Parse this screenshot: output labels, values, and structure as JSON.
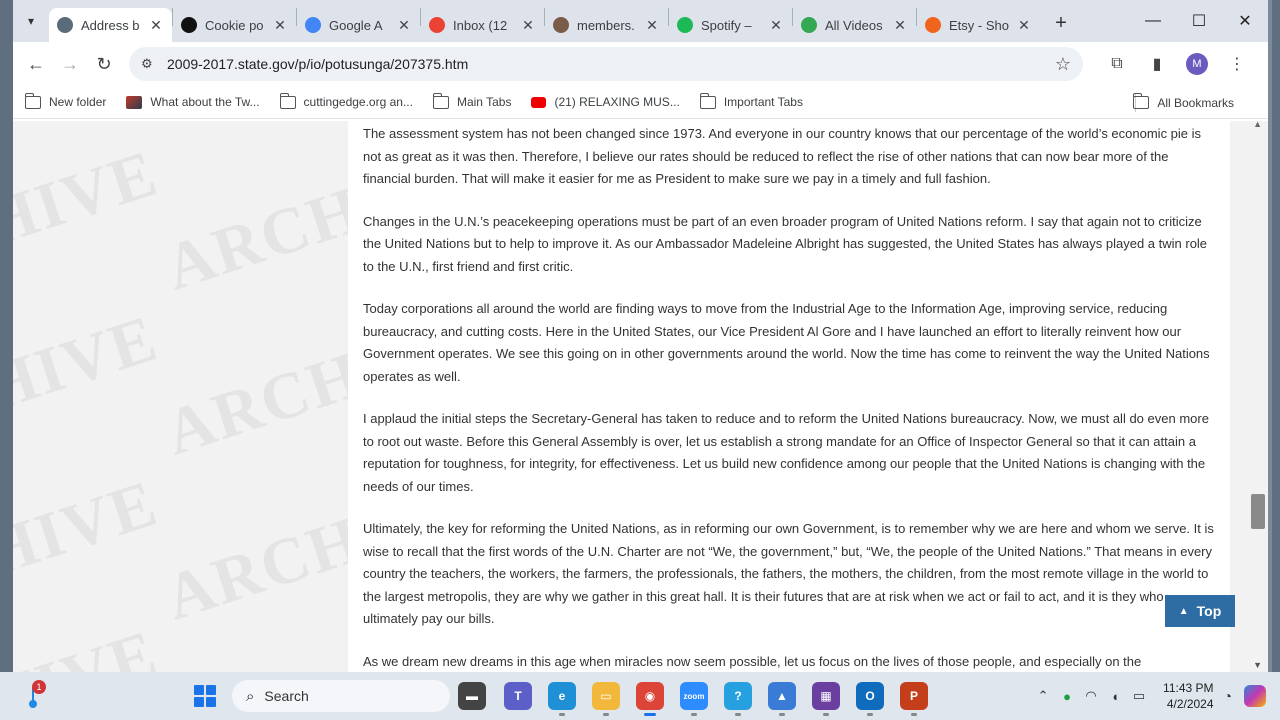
{
  "browser": {
    "tabs": [
      {
        "label": "Address b",
        "favicon": "state-dept-seal-icon",
        "color": "#5a6b7c",
        "active": true
      },
      {
        "label": "Cookie po",
        "favicon": "cookie-icon",
        "color": "#111111",
        "active": false
      },
      {
        "label": "Google A",
        "favicon": "google-icon",
        "color": "#4285f4",
        "active": false
      },
      {
        "label": "Inbox (12",
        "favicon": "gmail-icon",
        "color": "#ea4335",
        "active": false
      },
      {
        "label": "members.",
        "favicon": "members-icon",
        "color": "#7a5c48",
        "active": false
      },
      {
        "label": "Spotify –",
        "favicon": "spotify-icon",
        "color": "#1db954",
        "active": false
      },
      {
        "label": "All Videos",
        "favicon": "play-icon",
        "color": "#34a853",
        "active": false
      },
      {
        "label": "Etsy - Sho",
        "favicon": "etsy-icon",
        "color": "#f1641e",
        "active": false
      }
    ],
    "url": "2009-2017.state.gov/p/io/potusunga/207375.htm",
    "profile_initial": "M",
    "bookmarks": [
      {
        "label": "New folder",
        "icon": "folder-icon"
      },
      {
        "label": "What about the Tw...",
        "icon": "bookmark-site-icon"
      },
      {
        "label": "cuttingedge.org an...",
        "icon": "folder-icon"
      },
      {
        "label": "Main Tabs",
        "icon": "folder-icon"
      },
      {
        "label": "(21) RELAXING MUS...",
        "icon": "youtube-icon"
      },
      {
        "label": "Important Tabs",
        "icon": "folder-icon"
      }
    ],
    "all_bookmarks": "All Bookmarks"
  },
  "page": {
    "watermark_words": [
      "HIVE",
      "ARCH"
    ],
    "paragraphs": [
      "The assessment system has not been changed since 1973. And everyone in our country knows that our percentage of the world’s economic pie is not as great as it was then. Therefore, I believe our rates should be reduced to reflect the rise of other nations that can now bear more of the financial burden. That will make it easier for me as President to make sure we pay in a timely and full fashion.",
      "Changes in the U.N.’s peacekeeping operations must be part of an even broader program of United Nations reform. I say that again not to criticize the United Nations but to help to improve it. As our Ambassador Madeleine Albright has suggested, the United States has always played a twin role to the U.N., first friend and first critic.",
      "Today corporations all around the world are finding ways to move from the Industrial Age to the Information Age, improving service, reducing bureaucracy, and cutting costs. Here in the United States, our Vice President Al Gore and I have launched an effort to literally reinvent how our Government operates. We see this going on in other governments around the world. Now the time has come to reinvent the way the United Nations operates as well.",
      "I applaud the initial steps the Secretary-General has taken to reduce and to reform the United Nations bureaucracy. Now, we must all do even more to root out waste. Before this General Assembly is over, let us establish a strong mandate for an Office of Inspector General so that it can attain a reputation for toughness, for integrity, for effectiveness. Let us build new confidence among our people that the United Nations is changing with the needs of our times.",
      "Ultimately, the key for reforming the United Nations, as in reforming our own Government, is to remember why we are here and whom we serve. It is wise to recall that the first words of the U.N. Charter are not “We, the government,” but, “We, the people of the United Nations.” That means in every country the teachers, the workers, the farmers, the professionals, the fathers, the mothers, the children, from the most remote village in the world to the largest metropolis, they are why we gather in this great hall. It is their futures that are at risk when we act or fail to act, and it is they who ultimately pay our bills.",
      "As we dream new dreams in this age when miracles now seem possible, let us focus on the lives of those people, and especially on the"
    ],
    "top_button": "Top"
  },
  "taskbar": {
    "notification_count": "1",
    "search_placeholder": "Search",
    "time": "11:43 PM",
    "date": "4/2/2024",
    "apps": [
      {
        "name": "file-explorer-icon",
        "color": "#444444",
        "glyph": "▬"
      },
      {
        "name": "teams-icon",
        "color": "#5b5fc7",
        "glyph": "T"
      },
      {
        "name": "edge-icon",
        "color": "#1f8fd6",
        "glyph": "e"
      },
      {
        "name": "folder-app-icon",
        "color": "#f2b83b",
        "glyph": "▭"
      },
      {
        "name": "chrome-icon",
        "color": "#db4437",
        "glyph": "◉"
      },
      {
        "name": "zoom-icon",
        "color": "#2d8cff",
        "glyph": "zoom"
      },
      {
        "name": "help-icon",
        "color": "#27a0e0",
        "glyph": "?"
      },
      {
        "name": "photos-icon",
        "color": "#3a7bd5",
        "glyph": "▲"
      },
      {
        "name": "clipchamp-icon",
        "color": "#6b3fa0",
        "glyph": "▦"
      },
      {
        "name": "outlook-icon",
        "color": "#0f6cbd",
        "glyph": "O"
      },
      {
        "name": "powerpoint-icon",
        "color": "#c43e1c",
        "glyph": "P"
      }
    ]
  }
}
